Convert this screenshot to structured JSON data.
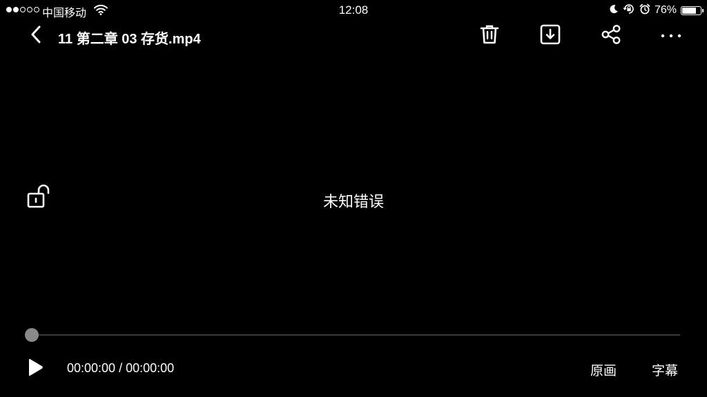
{
  "status_bar": {
    "signal_bars_filled": 2,
    "signal_bars_total": 5,
    "carrier": "中国移动",
    "time": "12:08",
    "battery_percent_text": "76%",
    "battery_level": 0.76,
    "icons": [
      "wifi-icon",
      "moon-icon",
      "orientation-lock-icon",
      "alarm-icon",
      "battery-icon"
    ]
  },
  "toolbar": {
    "back_icon": "chevron-left-icon",
    "title": "11 第二章 03 存货.mp4",
    "actions": [
      "trash-icon",
      "download-icon",
      "share-icon",
      "more-icon"
    ]
  },
  "player": {
    "lock_icon": "unlock-icon",
    "error_message": "未知错误",
    "progress_fraction": 0,
    "play_icon": "play-icon",
    "time_text": "00:00:00 / 00:00:00",
    "quality_label": "原画",
    "subtitle_label": "字幕"
  },
  "colors": {
    "background": "#000000",
    "foreground": "#ffffff",
    "track": "#3a3a3a",
    "thumb": "#8a8a8a"
  }
}
